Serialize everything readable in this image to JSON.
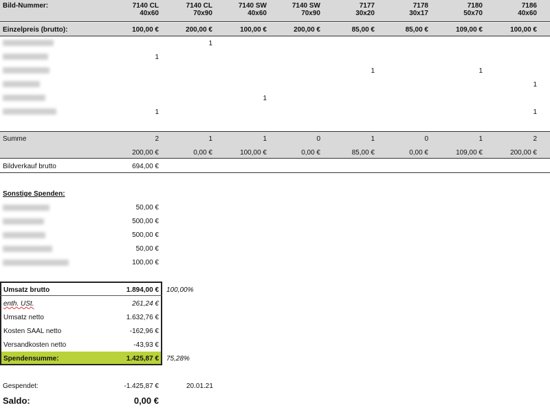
{
  "header": {
    "label": "Bild-Nummer:",
    "columns": [
      {
        "num": "7140 CL",
        "size": "40x60"
      },
      {
        "num": "7140 CL",
        "size": "70x90"
      },
      {
        "num": "7140 SW",
        "size": "40x60"
      },
      {
        "num": "7140 SW",
        "size": "70x90"
      },
      {
        "num": "7177",
        "size": "30x20"
      },
      {
        "num": "7178",
        "size": "30x17"
      },
      {
        "num": "7180",
        "size": "50x70"
      },
      {
        "num": "7186",
        "size": "40x60"
      }
    ]
  },
  "price_row": {
    "label": "Einzelpreis (brutto):",
    "values": [
      "100,00 €",
      "200,00 €",
      "100,00 €",
      "200,00 €",
      "85,00 €",
      "85,00 €",
      "109,00 €",
      "100,00 €"
    ]
  },
  "buyer_rows": [
    [
      "",
      "1",
      "",
      "",
      "",
      "",
      "",
      ""
    ],
    [
      "1",
      "",
      "",
      "",
      "",
      "",
      "",
      ""
    ],
    [
      "",
      "",
      "",
      "",
      "1",
      "",
      "1",
      ""
    ],
    [
      "",
      "",
      "",
      "",
      "",
      "",
      "",
      "1"
    ],
    [
      "",
      "",
      "1",
      "",
      "",
      "",
      "",
      ""
    ],
    [
      "1",
      "",
      "",
      "",
      "",
      "",
      "",
      "1"
    ]
  ],
  "summe": {
    "label": "Summe",
    "counts": [
      "2",
      "1",
      "1",
      "0",
      "1",
      "0",
      "1",
      "2"
    ],
    "amounts": [
      "200,00 €",
      "0,00 €",
      "100,00 €",
      "0,00 €",
      "85,00 €",
      "0,00 €",
      "109,00 €",
      "200,00 €"
    ]
  },
  "bildverkauf": {
    "label": "Bildverkauf brutto",
    "value": "694,00 €"
  },
  "spenden": {
    "title": "Sonstige Spenden:",
    "values": [
      "50,00 €",
      "500,00 €",
      "500,00 €",
      "50,00 €",
      "100,00 €"
    ]
  },
  "summary": {
    "umsatz_brutto_label": "Umsatz brutto",
    "umsatz_brutto_value": "1.894,00 €",
    "umsatz_brutto_pct": "100,00%",
    "ust_label": "enth. USt.",
    "ust_value": "261,24 €",
    "netto_label": "Umsatz netto",
    "netto_value": "1.632,76 €",
    "kosten_label": "Kosten SAAL netto",
    "kosten_value": "-162,96 €",
    "versand_label": "Versandkosten netto",
    "versand_value": "-43,93 €",
    "spendensumme_label": "Spendensumme:",
    "spendensumme_value": "1.425,87 €",
    "spendensumme_pct": "75,28%"
  },
  "gespendet": {
    "label": "Gespendet:",
    "value": "-1.425,87 €",
    "date": "20.01.21"
  },
  "saldo": {
    "label": "Saldo:",
    "value": "0,00 €"
  },
  "colors": {
    "band": "#d9d9d9",
    "highlight": "#b9d23a"
  }
}
